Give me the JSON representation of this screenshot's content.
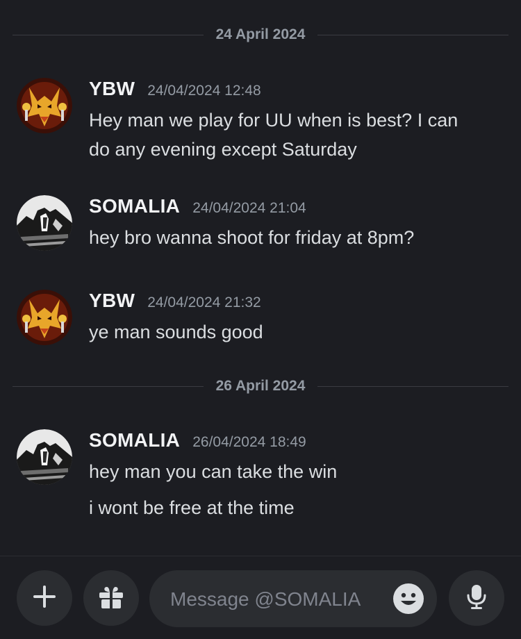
{
  "dividers": [
    {
      "label": "24 April 2024"
    },
    {
      "label": "26 April 2024"
    }
  ],
  "messages": [
    {
      "author": "YBW",
      "timestamp": "24/04/2024 12:48",
      "lines": [
        "Hey man we play for UU when is best? I can",
        "do any evening except Saturday"
      ]
    },
    {
      "author": "SOMALIA",
      "timestamp": "24/04/2024 21:04",
      "lines": [
        "hey bro wanna shoot for friday at 8pm?"
      ]
    },
    {
      "author": "YBW",
      "timestamp": "24/04/2024 21:32",
      "lines": [
        "ye man sounds good"
      ]
    },
    {
      "author": "SOMALIA",
      "timestamp": "26/04/2024 18:49",
      "lines": [
        "hey man you can take the win",
        "i wont be free at the time"
      ]
    }
  ],
  "composer": {
    "placeholder": "Message @SOMALIA",
    "value": "",
    "icons": [
      "plus-icon",
      "gift-icon",
      "emoji-icon",
      "microphone-icon"
    ]
  },
  "colors": {
    "background": "#1c1d22",
    "surface": "#2b2d31",
    "text": "#dbdee1",
    "muted": "#949ba4",
    "author": "#f2f3f5"
  }
}
